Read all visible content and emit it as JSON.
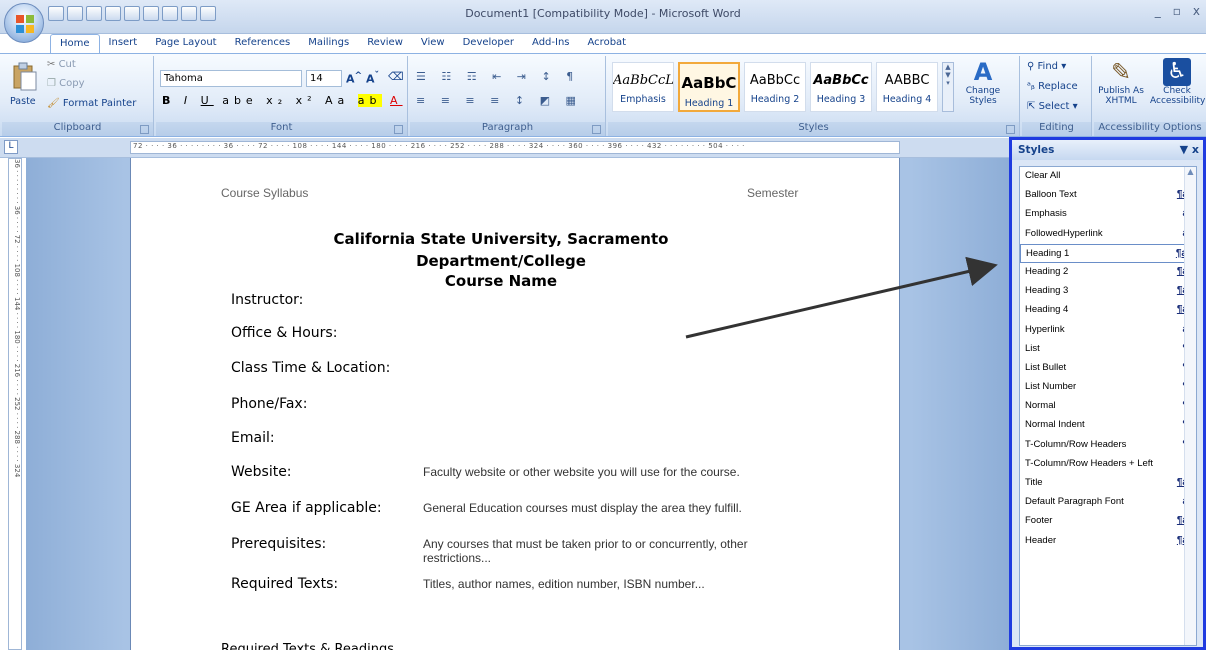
{
  "window": {
    "title": "Document1 [Compatibility Mode] - Microsoft Word",
    "min": "_",
    "restore": "▫",
    "close": "x"
  },
  "tabs": [
    "Home",
    "Insert",
    "Page Layout",
    "References",
    "Mailings",
    "Review",
    "View",
    "Developer",
    "Add-Ins",
    "Acrobat"
  ],
  "ribbon": {
    "clipboard": {
      "paste": "Paste",
      "cut": "Cut",
      "copy": "Copy",
      "format_painter": "Format Painter",
      "label": "Clipboard"
    },
    "font": {
      "name": "Tahoma",
      "size": "14",
      "label": "Font"
    },
    "paragraph": {
      "label": "Paragraph"
    },
    "styles": {
      "label": "Styles",
      "items": [
        {
          "sample": "AaBbCcL",
          "name": "Emphasis"
        },
        {
          "sample": "AaBbC",
          "name": "Heading 1"
        },
        {
          "sample": "AaBbCc",
          "name": "Heading 2"
        },
        {
          "sample": "AaBbCc",
          "name": "Heading 3"
        },
        {
          "sample": "AABBC",
          "name": "Heading 4"
        }
      ],
      "change_styles": "Change Styles"
    },
    "editing": {
      "find": "Find",
      "replace": "Replace",
      "select": "Select",
      "label": "Editing"
    },
    "accessibility": {
      "publish": "Publish As XHTML",
      "check": "Check Accessibility",
      "label": "Accessibility Options"
    }
  },
  "ruler": {
    "horizontal": "72 · · · · 36 · · · ·   · · · · 36 · · · · 72 · · · · 108 · · · · 144 · · · · 180 · · · · 216 · · · · 252 · · · · 288 · · · · 324 · · · · 360 · · · · 396 · · · · 432 · · · ·   · · · · 504 · · · ·",
    "vertical": "36 · · · ·   · · · · 36 · · · · 72 · · · · 108 · · · · 144 · · · · 180 · · · · 216 · · · · 252 · · · · 288 · · · · 324"
  },
  "document": {
    "header_left": "Course Syllabus",
    "header_right": "Semester",
    "title1": "California State University, Sacramento",
    "title2": "Department/College",
    "title3": "Course Name",
    "fields": [
      {
        "label": "Instructor:",
        "desc": ""
      },
      {
        "label": "Office & Hours:",
        "desc": ""
      },
      {
        "label": "Class Time & Location:",
        "desc": ""
      },
      {
        "label": "Phone/Fax:",
        "desc": ""
      },
      {
        "label": "Email:",
        "desc": ""
      },
      {
        "label": "Website:",
        "desc": "Faculty website or other website you will use for the course."
      },
      {
        "label": "GE Area if applicable:",
        "desc": "General Education courses must display the area they fulfill."
      },
      {
        "label": "Prerequisites:",
        "desc": "Any courses that must be taken prior to or concurrently, other restrictions..."
      },
      {
        "label": "Required Texts:",
        "desc": "Titles, author names, edition number, ISBN number..."
      }
    ],
    "footer_cut": "Required Texts & Readings"
  },
  "styles_pane": {
    "title": "Styles",
    "close": "▼ x",
    "items": [
      {
        "name": "Clear All",
        "glyph": ""
      },
      {
        "name": "Balloon Text",
        "glyph": "¶a"
      },
      {
        "name": "Emphasis",
        "glyph": "a"
      },
      {
        "name": "FollowedHyperlink",
        "glyph": "a"
      },
      {
        "name": "Heading 1",
        "glyph": "¶a"
      },
      {
        "name": "Heading 2",
        "glyph": "¶a"
      },
      {
        "name": "Heading 3",
        "glyph": "¶a"
      },
      {
        "name": "Heading 4",
        "glyph": "¶a"
      },
      {
        "name": "Hyperlink",
        "glyph": "a"
      },
      {
        "name": "List",
        "glyph": "¶"
      },
      {
        "name": "List Bullet",
        "glyph": "¶"
      },
      {
        "name": "List Number",
        "glyph": "¶"
      },
      {
        "name": "Normal",
        "glyph": "¶"
      },
      {
        "name": "Normal Indent",
        "glyph": "¶"
      },
      {
        "name": "T-Column/Row Headers",
        "glyph": "¶"
      },
      {
        "name": "T-Column/Row Headers + Left",
        "glyph": ""
      },
      {
        "name": "Title",
        "glyph": "¶a"
      },
      {
        "name": "Default Paragraph Font",
        "glyph": "a"
      },
      {
        "name": "Footer",
        "glyph": "¶a"
      },
      {
        "name": "Header",
        "glyph": "¶a"
      }
    ],
    "selected_index": 4
  },
  "colors": {
    "accent": "#15428b",
    "highlight_border": "#1f3be0",
    "ribbon_bg": "#dfe9f7"
  }
}
